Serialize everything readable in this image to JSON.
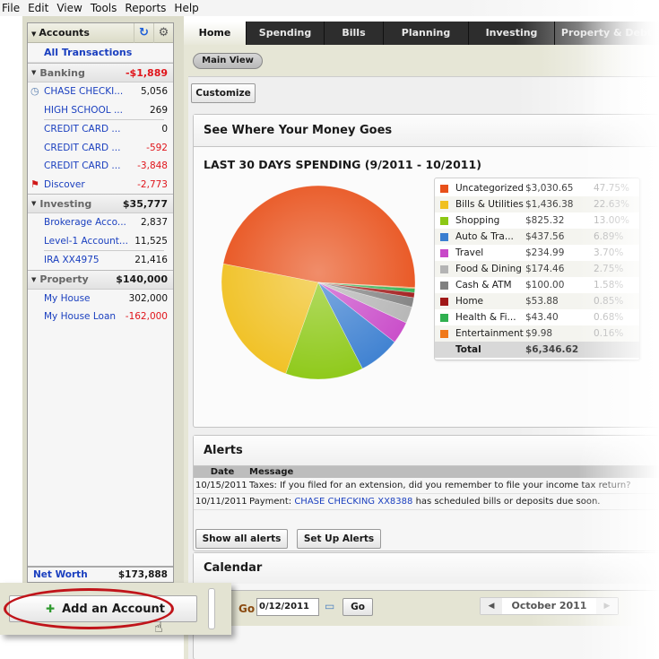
{
  "menu": [
    "File",
    "Edit",
    "View",
    "Tools",
    "Reports",
    "Help"
  ],
  "sidebar": {
    "title": "Accounts",
    "all_transactions": "All Transactions",
    "groups": [
      {
        "name": "Banking",
        "total": "-$1,889",
        "negative": true,
        "accounts": [
          {
            "name": "CHASE CHECKI...",
            "value": "5,056",
            "negative": false,
            "icon": "clock-icon"
          },
          {
            "name": "HIGH SCHOOL ...",
            "value": "269",
            "negative": false,
            "icon": ""
          },
          {
            "name": "CREDIT CARD ...",
            "value": "0",
            "negative": false,
            "icon": ""
          },
          {
            "name": "CREDIT CARD ...",
            "value": "-592",
            "negative": true,
            "icon": ""
          },
          {
            "name": "CREDIT CARD ...",
            "value": "-3,848",
            "negative": true,
            "icon": ""
          },
          {
            "name": "Discover",
            "value": "-2,773",
            "negative": true,
            "icon": "flag-icon"
          }
        ]
      },
      {
        "name": "Investing",
        "total": "$35,777",
        "negative": false,
        "accounts": [
          {
            "name": "Brokerage Acco...",
            "value": "2,837",
            "negative": false,
            "icon": ""
          },
          {
            "name": "Level-1 Account...",
            "value": "11,525",
            "negative": false,
            "icon": ""
          },
          {
            "name": "IRA XX4975",
            "value": "21,416",
            "negative": false,
            "icon": ""
          }
        ]
      },
      {
        "name": "Property",
        "total": "$140,000",
        "negative": false,
        "accounts": [
          {
            "name": "My House",
            "value": "302,000",
            "negative": false,
            "icon": ""
          },
          {
            "name": "My House Loan",
            "value": "-162,000",
            "negative": true,
            "icon": ""
          }
        ]
      }
    ],
    "net_worth_label": "Net Worth",
    "net_worth_value": "$173,888",
    "add_account": "Add an Account"
  },
  "tabs": [
    "Home",
    "Spending",
    "Bills",
    "Planning",
    "Investing",
    "Property & Debt"
  ],
  "active_tab": "Home",
  "main_view": "Main View",
  "customize": "Customize",
  "spending_panel": {
    "title": "See Where Your Money Goes",
    "subtitle": "LAST 30 DAYS SPENDING (9/2011 - 10/2011)"
  },
  "chart_data": {
    "type": "pie",
    "title": "LAST 30 DAYS SPENDING (9/2011 - 10/2011)",
    "start_direction": "east",
    "direction": "counterclockwise",
    "slices": [
      {
        "label": "Uncategorized",
        "amount": "$3,030.65",
        "value": 3030.65,
        "percent": "47.75%",
        "color": "#e8501a"
      },
      {
        "label": "Bills & Utilities",
        "amount": "$1,436.38",
        "value": 1436.38,
        "percent": "22.63%",
        "color": "#f0c020"
      },
      {
        "label": "Shopping",
        "amount": "$825.32",
        "value": 825.32,
        "percent": "13.00%",
        "color": "#8cc814"
      },
      {
        "label": "Auto & Tra...",
        "amount": "$437.56",
        "value": 437.56,
        "percent": "6.89%",
        "color": "#3a7ed0"
      },
      {
        "label": "Travel",
        "amount": "$234.99",
        "value": 234.99,
        "percent": "3.70%",
        "color": "#c848c8"
      },
      {
        "label": "Food & Dining",
        "amount": "$174.46",
        "value": 174.46,
        "percent": "2.75%",
        "color": "#b4b4b4"
      },
      {
        "label": "Cash & ATM",
        "amount": "$100.00",
        "value": 100.0,
        "percent": "1.58%",
        "color": "#808080"
      },
      {
        "label": "Home",
        "amount": "$53.88",
        "value": 53.88,
        "percent": "0.85%",
        "color": "#a01818"
      },
      {
        "label": "Health & Fi...",
        "amount": "$43.40",
        "value": 43.4,
        "percent": "0.68%",
        "color": "#30b050"
      },
      {
        "label": "Entertainment",
        "amount": "$9.98",
        "value": 9.98,
        "percent": "0.16%",
        "color": "#f07818"
      }
    ],
    "total_label": "Total",
    "total_amount": "$6,346.62"
  },
  "alerts": {
    "title": "Alerts",
    "columns": [
      "Date",
      "Message"
    ],
    "rows": [
      {
        "date": "10/15/2011",
        "prefix": "Taxes: If you filed for an extension, did you remember to file your income tax return?",
        "link": "",
        "suffix": ""
      },
      {
        "date": "10/11/2011",
        "prefix": "Payment: ",
        "link": "CHASE CHECKING XX8388",
        "suffix": " has scheduled bills or deposits due soon."
      }
    ],
    "show_all": "Show all alerts",
    "setup": "Set Up Alerts"
  },
  "calendar": {
    "title": "Calendar",
    "go_label": "Go",
    "date_value": "0/12/2011",
    "go_button": "Go",
    "month": "October 2011"
  }
}
